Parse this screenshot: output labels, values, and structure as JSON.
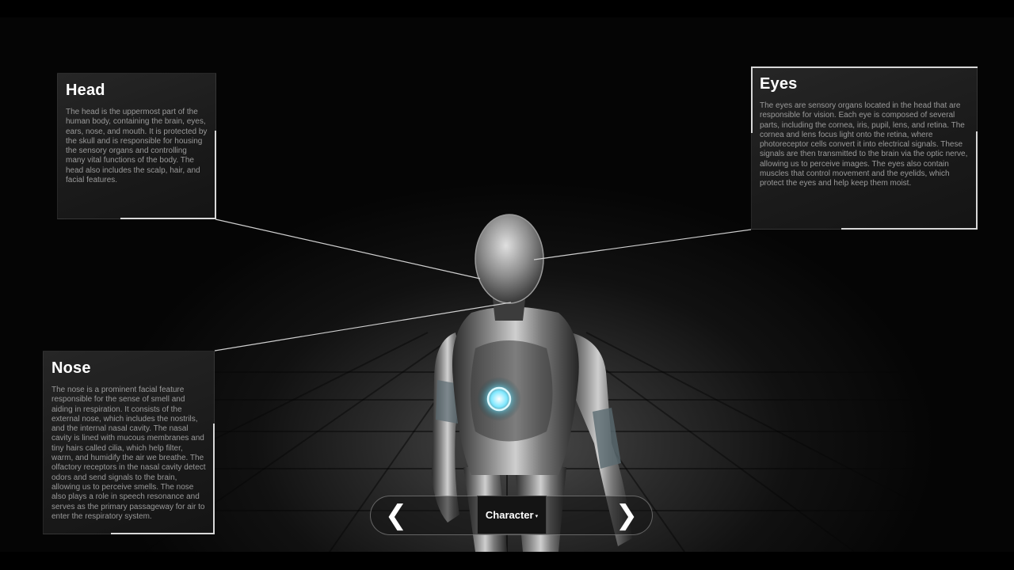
{
  "panels": {
    "head": {
      "title": "Head",
      "body": "The head is the uppermost part of the human body, containing the brain, eyes, ears, nose, and mouth. It is protected by the skull and is responsible for housing the sensory organs and controlling many vital functions of the body. The head also includes the scalp, hair, and facial features."
    },
    "eyes": {
      "title": "Eyes",
      "body": "The eyes are sensory organs located in the head that are responsible for vision. Each eye is composed of several parts, including the cornea, iris, pupil, lens, and retina. The cornea and lens focus light onto the retina, where photoreceptor cells convert it into electrical signals. These signals are then transmitted to the brain via the optic nerve, allowing us to perceive images. The eyes also contain muscles that control movement and the eyelids, which protect the eyes and help keep them moist."
    },
    "nose": {
      "title": "Nose",
      "body": "The nose is a prominent facial feature responsible for the sense of smell and aiding in respiration. It consists of the external nose, which includes the nostrils, and the internal nasal cavity. The nasal cavity is lined with mucous membranes and tiny hairs called cilia, which help filter, warm, and humidify the air we breathe. The olfactory receptors in the nasal cavity detect odors and send signals to the brain, allowing us to perceive smells. The nose also plays a role in speech resonance and serves as the primary passageway for air to enter the respiratory system."
    }
  },
  "nav": {
    "prev_icon": "chevron-left-icon",
    "next_icon": "chevron-right-icon",
    "prev_glyph": "❮",
    "next_glyph": "❯",
    "selected": "Character",
    "caret_icon": "caret-down-icon",
    "caret_glyph": "▾"
  },
  "colors": {
    "core_glow": "#7fe8ff",
    "panel_bg": "#1c1c1c",
    "body_text": "#9a9a9a"
  }
}
